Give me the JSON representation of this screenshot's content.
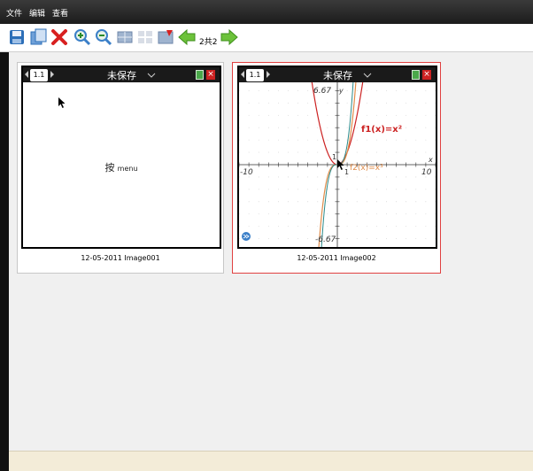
{
  "menu": {
    "file": "文件",
    "edit": "编辑",
    "view": "查看"
  },
  "toolbar": {
    "save_icon": "save-icon",
    "page_info": "2共2",
    "icons": [
      "save-icon",
      "copy-icon",
      "delete-icon",
      "zoom-in-icon",
      "zoom-out-icon",
      "grid-icon",
      "layout-icon",
      "image-icon",
      "back-arrow-icon",
      "forward-arrow-icon"
    ]
  },
  "thumbnails": [
    {
      "caption": "12-05-2011 Image001",
      "tab": "1.1",
      "title": "未保存",
      "body_prefix": "按",
      "body_text": "menu"
    },
    {
      "caption": "12-05-2011 Image002",
      "tab": "1.1",
      "title": "未保存",
      "graph": {
        "ymax_label": "6.67",
        "ymin_label": "-6.67",
        "xmin_label": "-10",
        "xmax_label": "10",
        "xaxis": "x",
        "yaxis": "y",
        "one_x": "1",
        "one_y": "1",
        "f1_label": "f1(x)=x²",
        "f2_label": "f2(x)=x³",
        "f1_color": "#cc2222",
        "f2_color": "#e08c4a"
      }
    }
  ],
  "colors": {
    "selected_border": "#e04040",
    "status_bg": "#f3ecd8"
  }
}
